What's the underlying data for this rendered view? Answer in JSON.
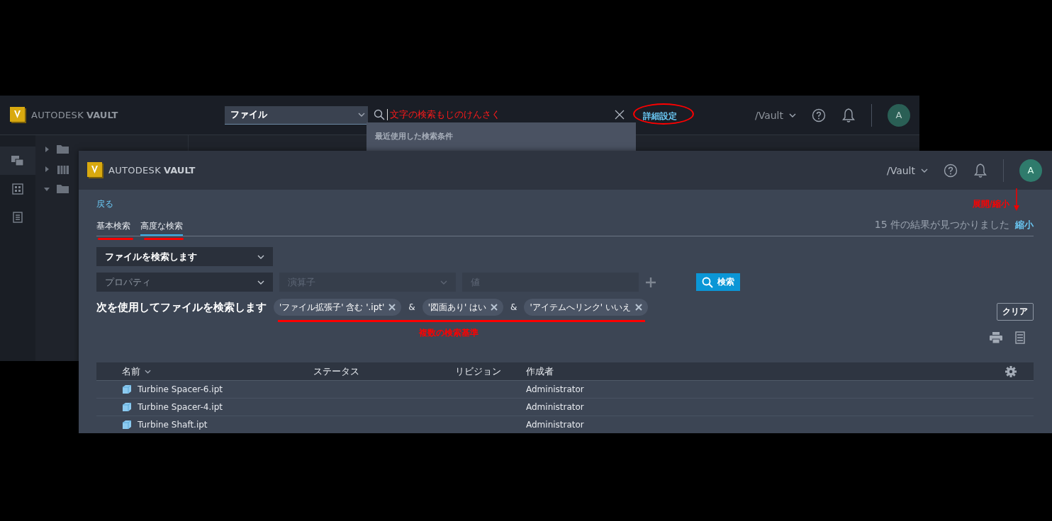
{
  "back_window": {
    "logo": {
      "brand": "AUTODESK",
      "product": "VAULT"
    },
    "search": {
      "scope": "ファイル",
      "value": "文字の検索もじのけんさく",
      "advanced_link": "詳細設定",
      "recent_heading": "最近使用した検索条件"
    },
    "vault": "/Vault",
    "avatar": "A",
    "sidebar": [
      {
        "kind": "files",
        "selected": true
      },
      {
        "kind": "grid",
        "selected": false
      },
      {
        "kind": "list",
        "selected": false
      }
    ],
    "tree": [
      {
        "kind": "folder",
        "expanded": false
      },
      {
        "kind": "library",
        "expanded": false
      },
      {
        "kind": "folder",
        "expanded": true
      }
    ]
  },
  "front_window": {
    "logo": {
      "brand": "AUTODESK",
      "product": "VAULT"
    },
    "vault": "/Vault",
    "avatar": "A",
    "back_link": "戻る",
    "tabs": [
      {
        "label": "基本検索",
        "selected": false
      },
      {
        "label": "高度な検索",
        "selected": true
      }
    ],
    "result_count": "15 件の結果が見つかりました",
    "collapse_link": "縮小",
    "search_type": "ファイルを検索します",
    "property": {
      "placeholder": "プロパティ"
    },
    "operator": {
      "placeholder": "演算子",
      "disabled": true
    },
    "value": {
      "placeholder": "値"
    },
    "search_button": "検索",
    "criteria_label": "次を使用してファイルを検索します",
    "criteria": [
      {
        "text": "'ファイル拡張子' 含む '.ipt'"
      },
      {
        "joiner": "&",
        "text": "'図面あり' はい"
      },
      {
        "joiner": "&",
        "text": "'アイテムへリンク' いいえ"
      }
    ],
    "clear_button": "クリア",
    "table": {
      "columns": [
        "名前",
        "ステータス",
        "リビジョン",
        "作成者"
      ],
      "rows": [
        {
          "name": "Turbine Spacer-6.ipt",
          "created_by": "Administrator"
        },
        {
          "name": "Turbine Spacer-4.ipt",
          "created_by": "Administrator"
        },
        {
          "name": "Turbine Shaft.ipt",
          "created_by": "Administrator"
        }
      ]
    },
    "annotations": {
      "criteria_note": "複数の検索基準",
      "collapse_note": "展開/縮小"
    }
  }
}
